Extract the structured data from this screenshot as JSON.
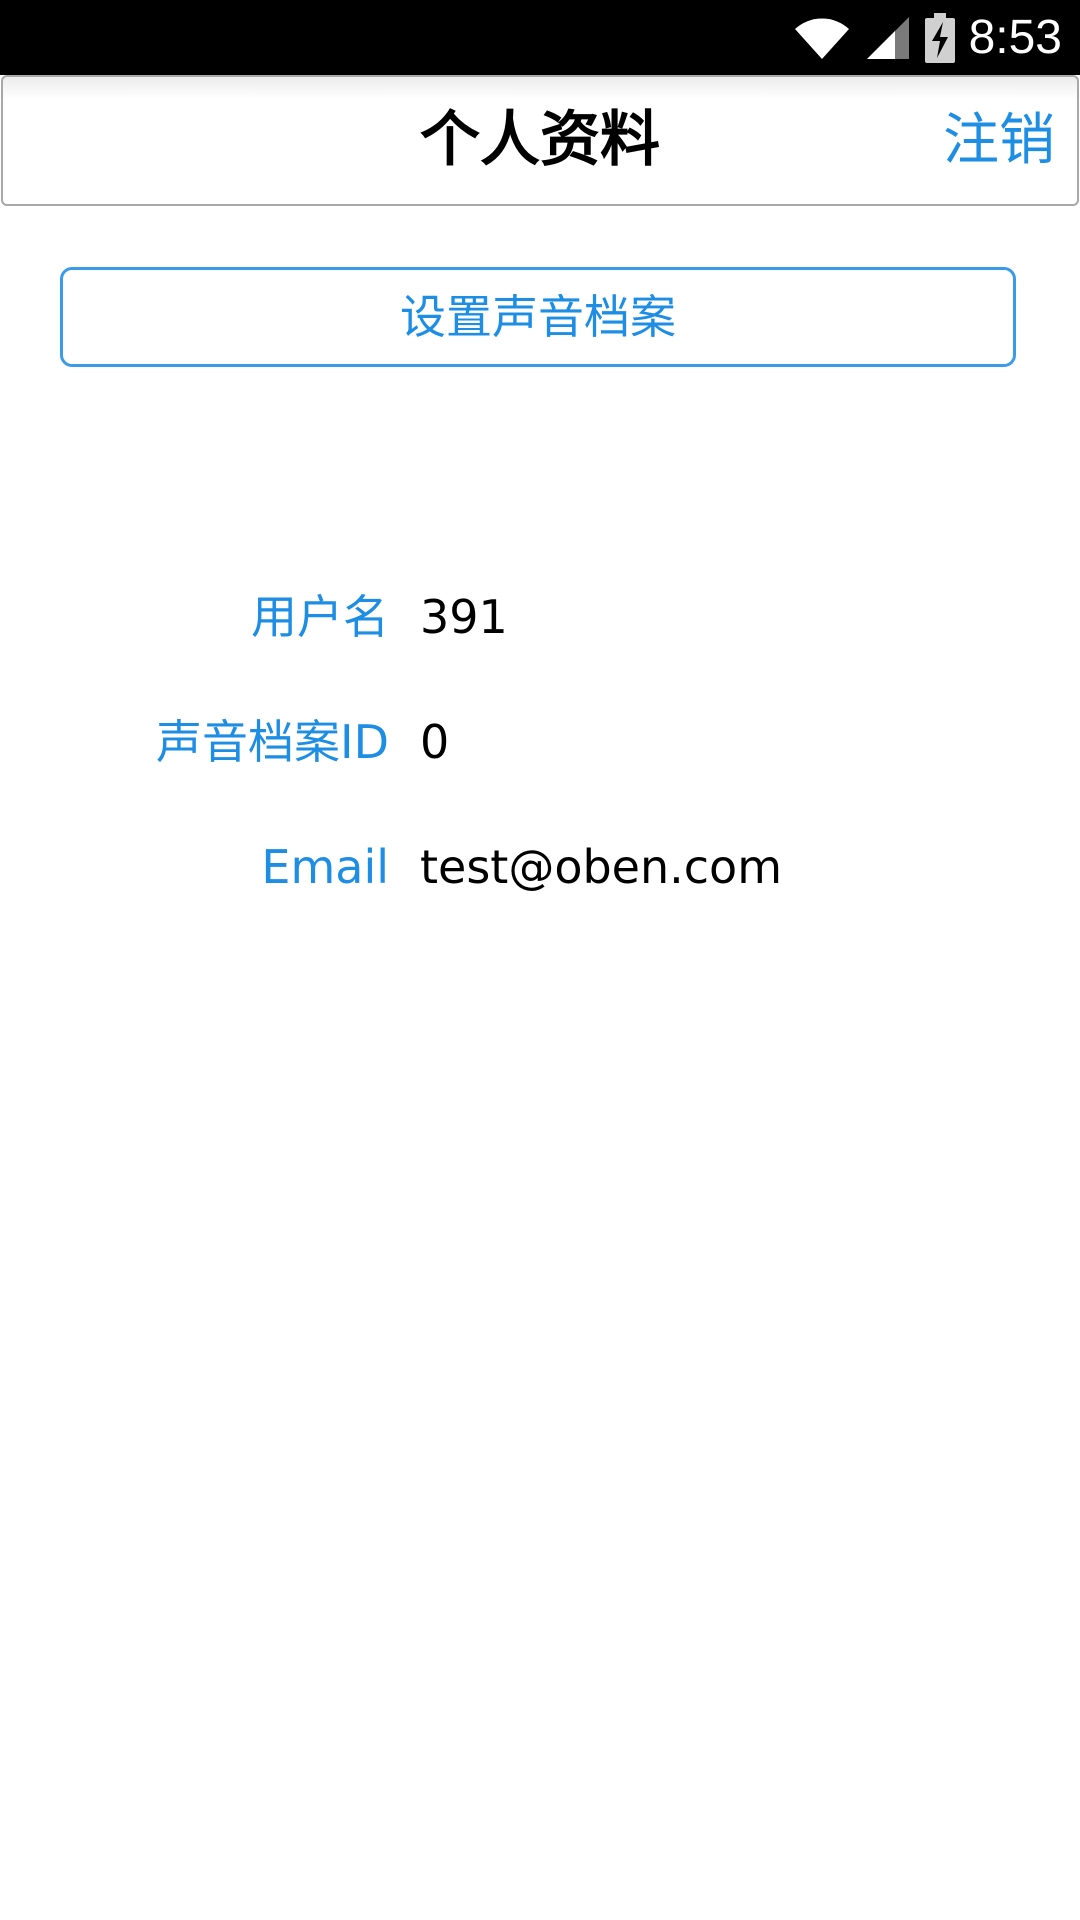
{
  "status_bar": {
    "time": "8:53",
    "icons": [
      "wifi-icon",
      "signal-icon",
      "battery-charging-icon"
    ]
  },
  "header": {
    "title": "个人资料",
    "logout_label": "注销"
  },
  "actions": {
    "setup_voice_profile_label": "设置声音档案"
  },
  "profile": {
    "username": {
      "label": "用户名",
      "value": "391"
    },
    "voice_profile_id": {
      "label": "声音档案ID",
      "value": "0"
    },
    "email": {
      "label": "Email",
      "value": "test@oben.com"
    }
  },
  "colors": {
    "accent": "#1e8ee4",
    "button_border": "#3a9be8",
    "status_bar_bg": "#000000",
    "header_border": "#a8a8a8"
  }
}
